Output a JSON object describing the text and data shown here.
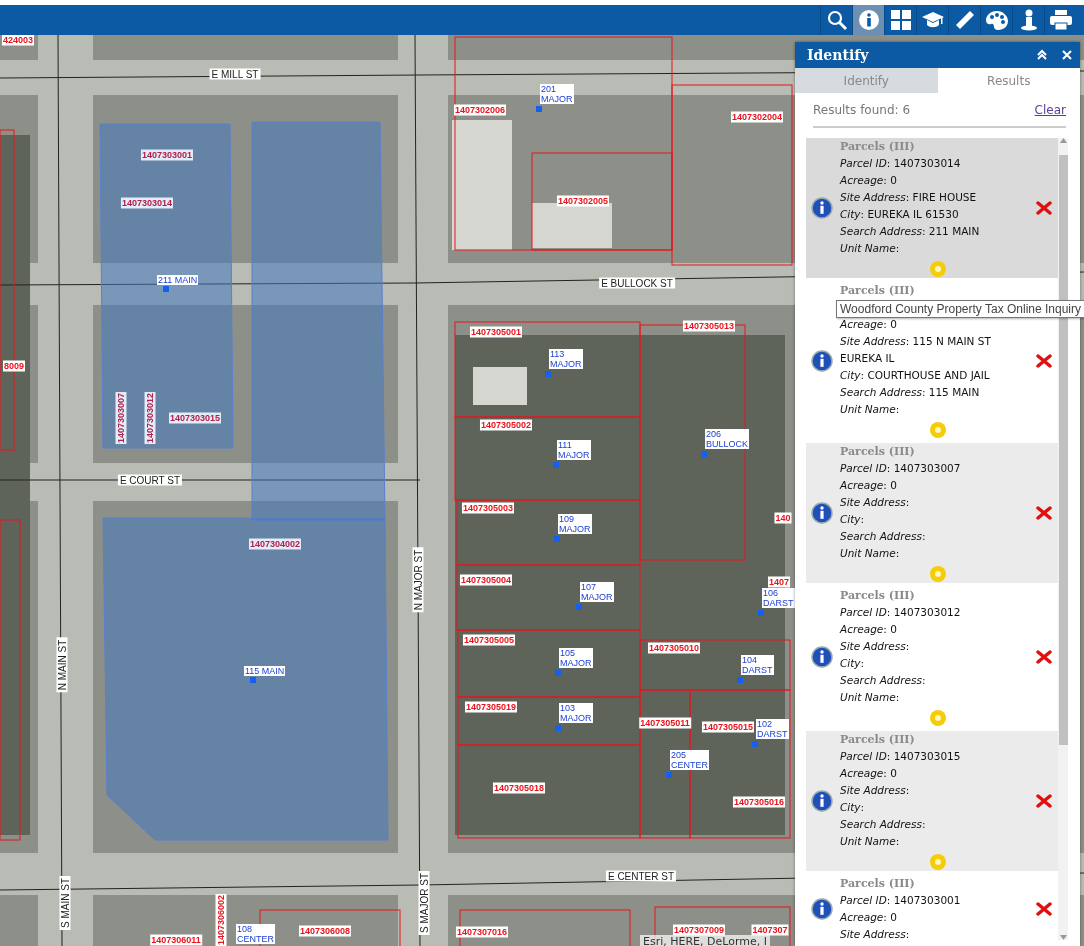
{
  "toolbar": {
    "tools": [
      {
        "kind": "search",
        "selected": false
      },
      {
        "kind": "info",
        "selected": true
      },
      {
        "kind": "grid",
        "selected": false
      },
      {
        "kind": "cap",
        "selected": false
      },
      {
        "kind": "ruler",
        "selected": false
      },
      {
        "kind": "palette",
        "selected": false
      },
      {
        "kind": "person",
        "selected": false
      },
      {
        "kind": "print",
        "selected": false
      }
    ]
  },
  "map": {
    "streets": [
      {
        "name": "E MILL ST",
        "kind": "horizontal"
      },
      {
        "name": "E BULLOCK ST",
        "kind": "horizontal"
      },
      {
        "name": "E COURT ST",
        "kind": "horizontal"
      },
      {
        "name": "E CENTER ST",
        "kind": "horizontal"
      },
      {
        "name": "N MAJOR ST",
        "kind": "vertical"
      },
      {
        "name": "N MAIN ST",
        "kind": "vertical"
      },
      {
        "name": "S MAIN ST",
        "kind": "vertical"
      },
      {
        "name": "S MAJOR ST",
        "kind": "vertical"
      }
    ],
    "parcel_labels": [
      {
        "text": "424003",
        "kind": "horizontal",
        "selected": false
      },
      {
        "text": "1407303001",
        "kind": "horizontal",
        "selected": true
      },
      {
        "text": "1407303014",
        "kind": "horizontal",
        "selected": true
      },
      {
        "text": "1407303007",
        "kind": "vertical",
        "selected": true
      },
      {
        "text": "1407303012",
        "kind": "vertical",
        "selected": true
      },
      {
        "text": "1407303015",
        "kind": "horizontal",
        "selected": true
      },
      {
        "text": "1407304002",
        "kind": "horizontal",
        "selected": true
      },
      {
        "text": "8009",
        "kind": "horizontal",
        "selected": false
      },
      {
        "text": "1407302006",
        "kind": "horizontal",
        "selected": false
      },
      {
        "text": "1407302005",
        "kind": "horizontal",
        "selected": false
      },
      {
        "text": "1407302004",
        "kind": "horizontal",
        "selected": false
      },
      {
        "text": "1407305001",
        "kind": "horizontal",
        "selected": false
      },
      {
        "text": "1407305013",
        "kind": "horizontal",
        "selected": false
      },
      {
        "text": "1407305002",
        "kind": "horizontal",
        "selected": false
      },
      {
        "text": "1407305003",
        "kind": "horizontal",
        "selected": false
      },
      {
        "text": "140",
        "kind": "horizontal",
        "selected": false
      },
      {
        "text": "1407305004",
        "kind": "horizontal",
        "selected": false
      },
      {
        "text": "1407",
        "kind": "horizontal",
        "selected": false
      },
      {
        "text": "1407305005",
        "kind": "horizontal",
        "selected": false
      },
      {
        "text": "1407305010",
        "kind": "horizontal",
        "selected": false
      },
      {
        "text": "1407305019",
        "kind": "horizontal",
        "selected": false
      },
      {
        "text": "1407305011",
        "kind": "horizontal",
        "selected": false
      },
      {
        "text": "1407305015",
        "kind": "horizontal",
        "selected": false
      },
      {
        "text": "1407305018",
        "kind": "horizontal",
        "selected": false
      },
      {
        "text": "1407305016",
        "kind": "horizontal",
        "selected": false
      },
      {
        "text": "1407306011",
        "kind": "horizontal",
        "selected": false
      },
      {
        "text": "1407306002",
        "kind": "vertical",
        "selected": false
      },
      {
        "text": "1407306008",
        "kind": "horizontal",
        "selected": false
      },
      {
        "text": "1407307016",
        "kind": "horizontal",
        "selected": false
      },
      {
        "text": "1407307009",
        "kind": "horizontal",
        "selected": false
      },
      {
        "text": "1407307",
        "kind": "horizontal",
        "selected": false
      }
    ],
    "address_labels": [
      {
        "number": "211",
        "street": "MAIN",
        "kind": "inline"
      },
      {
        "number": "201",
        "street": "MAJOR",
        "kind": "stacked"
      },
      {
        "number": "113",
        "street": "MAJOR",
        "kind": "stacked"
      },
      {
        "number": "111",
        "street": "MAJOR",
        "kind": "stacked"
      },
      {
        "number": "206",
        "street": "BULLOCK",
        "kind": "stacked"
      },
      {
        "number": "109",
        "street": "MAJOR",
        "kind": "stacked"
      },
      {
        "number": "107",
        "street": "MAJOR",
        "kind": "stacked"
      },
      {
        "number": "106",
        "street": "DARST",
        "kind": "stacked"
      },
      {
        "number": "105",
        "street": "MAJOR",
        "kind": "stacked"
      },
      {
        "number": "104",
        "street": "DARST",
        "kind": "stacked"
      },
      {
        "number": "103",
        "street": "MAJOR",
        "kind": "stacked"
      },
      {
        "number": "102",
        "street": "DARST",
        "kind": "stacked"
      },
      {
        "number": "205",
        "street": "CENTER",
        "kind": "stacked"
      },
      {
        "number": "115",
        "street": "MAIN",
        "kind": "inline"
      },
      {
        "number": "108",
        "street": "CENTER",
        "kind": "stacked"
      }
    ],
    "attribution": "Esri, HERE, DeLorme, I"
  },
  "panel": {
    "title": "Identify",
    "tabs": [
      {
        "label": "Identify",
        "selected": false
      },
      {
        "label": "Results",
        "selected": true
      }
    ],
    "results_found": "Results found: 6",
    "clear_link": "Clear",
    "results": [
      {
        "layer": "Parcels (III)",
        "selected": true,
        "fields": [
          "*Parcel ID*: 1407303014",
          "*Acreage*: 0",
          "*Site Address*: FIRE HOUSE",
          "*City*: EUREKA IL 61530",
          "*Search Address*: 211 MAIN",
          "*Unit Name*:"
        ]
      },
      {
        "layer": "Parcels (III)",
        "selected": false,
        "tooltip": "Woodford County Property Tax Online Inquiry",
        "fields": [
          "*Acreage*: 0",
          "*Site Address*: 115 N MAIN ST EUREKA IL",
          "*City*: COURTHOUSE AND JAIL",
          "*Search Address*: 115 MAIN",
          "*Unit Name*:"
        ]
      },
      {
        "layer": "Parcels (III)",
        "selected": false,
        "fields": [
          "*Parcel ID*: 1407303007",
          "*Acreage*: 0",
          "*Site Address*:",
          "*City*:",
          "*Search Address*:",
          "*Unit Name*:"
        ]
      },
      {
        "layer": "Parcels (III)",
        "selected": false,
        "fields": [
          "*Parcel ID*: 1407303012",
          "*Acreage*: 0",
          "*Site Address*:",
          "*City*:",
          "*Search Address*:",
          "*Unit Name*:"
        ]
      },
      {
        "layer": "Parcels (III)",
        "selected": false,
        "fields": [
          "*Parcel ID*: 1407303015",
          "*Acreage*: 0",
          "*Site Address*:",
          "*City*:",
          "*Search Address*:",
          "*Unit Name*:"
        ]
      },
      {
        "layer": "Parcels (III)",
        "selected": false,
        "fields": [
          "*Parcel ID*: 1407303001",
          "*Acreage*: 0",
          "*Site Address*:"
        ]
      }
    ]
  }
}
